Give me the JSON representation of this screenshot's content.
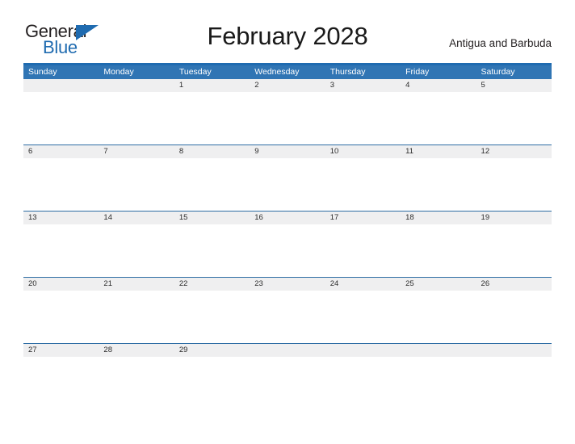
{
  "brand": {
    "word_one": "General",
    "word_two": "Blue",
    "triangle_icon": "triangle-icon",
    "accent_color": "#1f6bb0"
  },
  "header": {
    "title": "February 2028",
    "region": "Antigua and Barbuda"
  },
  "calendar": {
    "header_bg": "#3075b4",
    "band_bg": "#efeff0",
    "rule_color": "#1f6bb0",
    "weekdays": [
      "Sunday",
      "Monday",
      "Tuesday",
      "Wednesday",
      "Thursday",
      "Friday",
      "Saturday"
    ],
    "weeks": [
      [
        "",
        "",
        "1",
        "2",
        "3",
        "4",
        "5"
      ],
      [
        "6",
        "7",
        "8",
        "9",
        "10",
        "11",
        "12"
      ],
      [
        "13",
        "14",
        "15",
        "16",
        "17",
        "18",
        "19"
      ],
      [
        "20",
        "21",
        "22",
        "23",
        "24",
        "25",
        "26"
      ],
      [
        "27",
        "28",
        "29",
        "",
        "",
        "",
        ""
      ]
    ]
  }
}
